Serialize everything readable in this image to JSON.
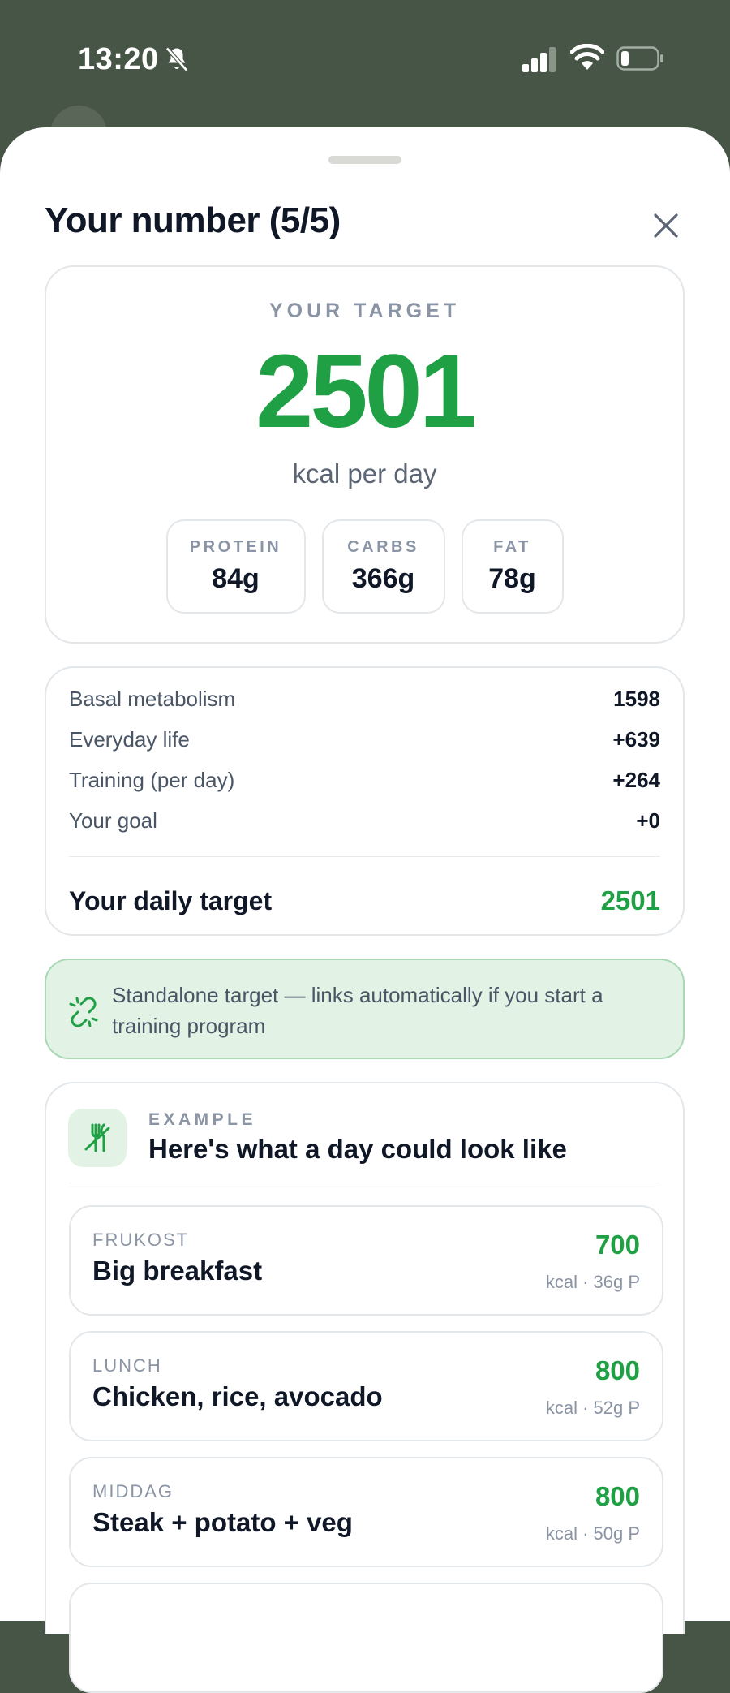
{
  "status_bar": {
    "time": "13:20"
  },
  "sheet": {
    "title": "Your number (5/5)"
  },
  "target": {
    "label": "YOUR TARGET",
    "value": "2501",
    "unit": "kcal per day",
    "macros": [
      {
        "label": "PROTEIN",
        "value": "84g"
      },
      {
        "label": "CARBS",
        "value": "366g"
      },
      {
        "label": "FAT",
        "value": "78g"
      }
    ]
  },
  "breakdown": {
    "rows": [
      {
        "label": "Basal metabolism",
        "value": "1598"
      },
      {
        "label": "Everyday life",
        "value": "+639"
      },
      {
        "label": "Training (per day)",
        "value": "+264"
      },
      {
        "label": "Your goal",
        "value": "+0"
      }
    ],
    "total_label": "Your daily target",
    "total_value": "2501"
  },
  "notice": {
    "text": "Standalone target — links automatically if you start a training program"
  },
  "example": {
    "kicker": "EXAMPLE",
    "title": "Here's what a day could look like",
    "meals": [
      {
        "kicker": "FRUKOST",
        "name": "Big breakfast",
        "kcal": "700",
        "meta": "kcal · 36g P"
      },
      {
        "kicker": "LUNCH",
        "name": "Chicken, rice, avocado",
        "kcal": "800",
        "meta": "kcal · 52g P"
      },
      {
        "kicker": "MIDDAG",
        "name": "Steak + potato + veg",
        "kcal": "800",
        "meta": "kcal · 50g P"
      }
    ]
  },
  "colors": {
    "accent_green": "#1fa045",
    "header_bg": "#475546",
    "notice_bg": "#e2f3e6"
  },
  "icons": [
    "bell-slash-icon",
    "cellular-signal-icon",
    "wifi-icon",
    "battery-icon",
    "close-icon",
    "link-break-icon",
    "utensils-slash-icon"
  ]
}
